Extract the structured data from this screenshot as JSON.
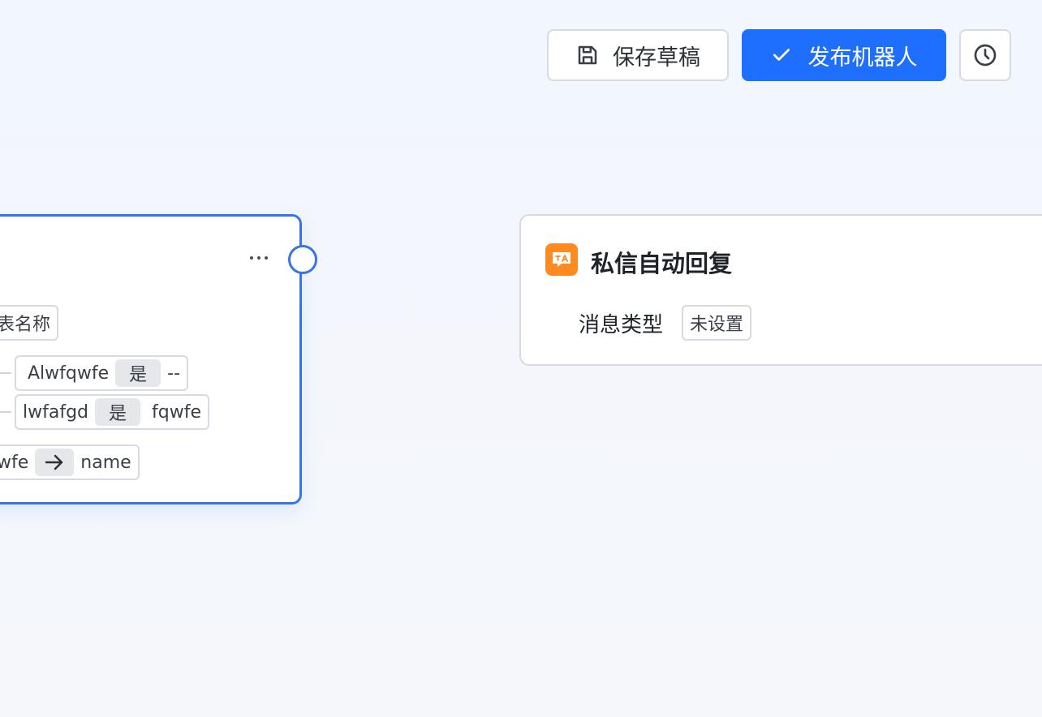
{
  "toolbar": {
    "save_draft_label": "保存草稿",
    "publish_label": "发布机器人",
    "icons": {
      "save": "save-icon",
      "publish": "check-icon",
      "history": "clock-icon"
    }
  },
  "left_node": {
    "name_chip": "表名称",
    "rows": [
      {
        "field": "Alwfqwfe",
        "operator": "是",
        "value": "--"
      },
      {
        "field": "lwfafgd",
        "operator": "是",
        "value": "fqwfe"
      }
    ],
    "mapping": {
      "source": "wfe",
      "target": "name"
    }
  },
  "right_node": {
    "title": "私信自动回复",
    "field_label": "消息类型",
    "field_value": "未设置",
    "icon": "translate-message-icon"
  },
  "colors": {
    "accent": "#1f6fff",
    "node_border_active": "#3574f0",
    "app_icon": "#ff8a1f"
  }
}
